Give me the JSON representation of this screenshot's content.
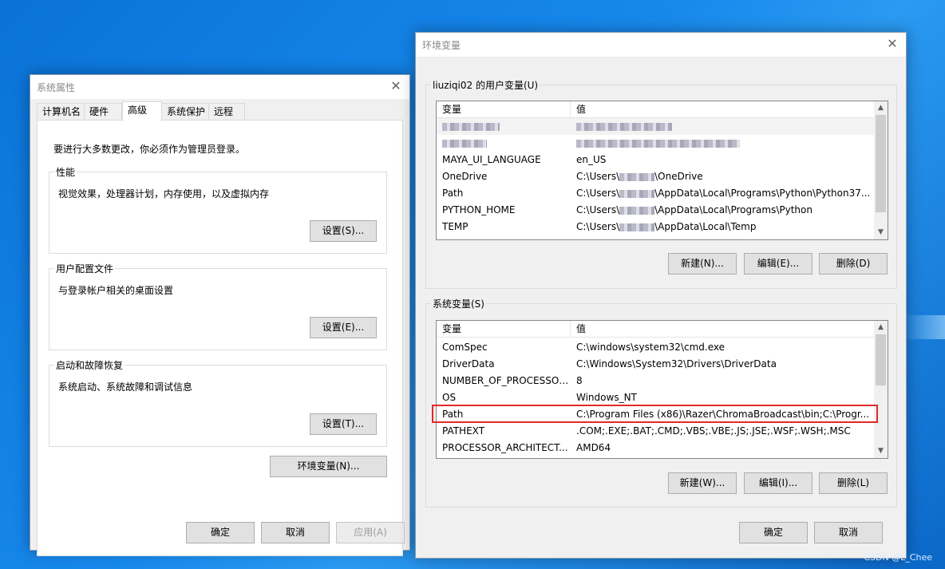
{
  "sysprops": {
    "title": "系统属性",
    "tabs": [
      "计算机名",
      "硬件",
      "高级",
      "系统保护",
      "远程"
    ],
    "admin_note": "要进行大多数更改，你必须作为管理员登录。",
    "performance": {
      "title": "性能",
      "desc": "视觉效果，处理器计划，内存使用，以及虚拟内存",
      "button": "设置(S)..."
    },
    "profile": {
      "title": "用户配置文件",
      "desc": "与登录帐户相关的桌面设置",
      "button": "设置(E)..."
    },
    "startup": {
      "title": "启动和故障恢复",
      "desc": "系统启动、系统故障和调试信息",
      "button": "设置(T)..."
    },
    "env_button": "环境变量(N)...",
    "ok": "确定",
    "cancel": "取消",
    "apply": "应用(A)"
  },
  "envvars": {
    "title": "环境变量",
    "user_group_title": "liuziqi02 的用户变量(U)",
    "columns": [
      "变量",
      "值"
    ],
    "user_rows": [
      {
        "name": "MAYA_UI_LANGUAGE",
        "value": "en_US"
      },
      {
        "name": "OneDrive",
        "value_pre": "C:\\Users\\",
        "value_post": "\\OneDrive"
      },
      {
        "name": "Path",
        "value_pre": "C:\\Users\\",
        "value_post": "\\AppData\\Local\\Programs\\Python\\Python37..."
      },
      {
        "name": "PYTHON_HOME",
        "value_pre": "C:\\Users\\",
        "value_post": "\\AppData\\Local\\Programs\\Python"
      },
      {
        "name": "TEMP",
        "value_pre": "C:\\Users\\",
        "value_post": "\\AppData\\Local\\Temp"
      }
    ],
    "user_buttons": {
      "new": "新建(N)...",
      "edit": "编辑(E)...",
      "delete": "删除(D)"
    },
    "system_group_title": "系统变量(S)",
    "system_rows": [
      {
        "name": "ComSpec",
        "value": "C:\\windows\\system32\\cmd.exe"
      },
      {
        "name": "DriverData",
        "value": "C:\\Windows\\System32\\Drivers\\DriverData"
      },
      {
        "name": "NUMBER_OF_PROCESSORS",
        "value": "8"
      },
      {
        "name": "OS",
        "value": "Windows_NT"
      },
      {
        "name": "Path",
        "value": "C:\\Program Files (x86)\\Razer\\ChromaBroadcast\\bin;C:\\Progr..."
      },
      {
        "name": "PATHEXT",
        "value": ".COM;.EXE;.BAT;.CMD;.VBS;.VBE;.JS;.JSE;.WSF;.WSH;.MSC"
      },
      {
        "name": "PROCESSOR_ARCHITECT...",
        "value": "AMD64"
      }
    ],
    "system_buttons": {
      "new": "新建(W)...",
      "edit": "编辑(I)...",
      "delete": "删除(L)"
    },
    "ok": "确定",
    "cancel": "取消"
  },
  "watermark": "CSDN @L_Chee",
  "colors": {
    "highlight": "#e12a2a",
    "desktop": "#1789ec"
  }
}
